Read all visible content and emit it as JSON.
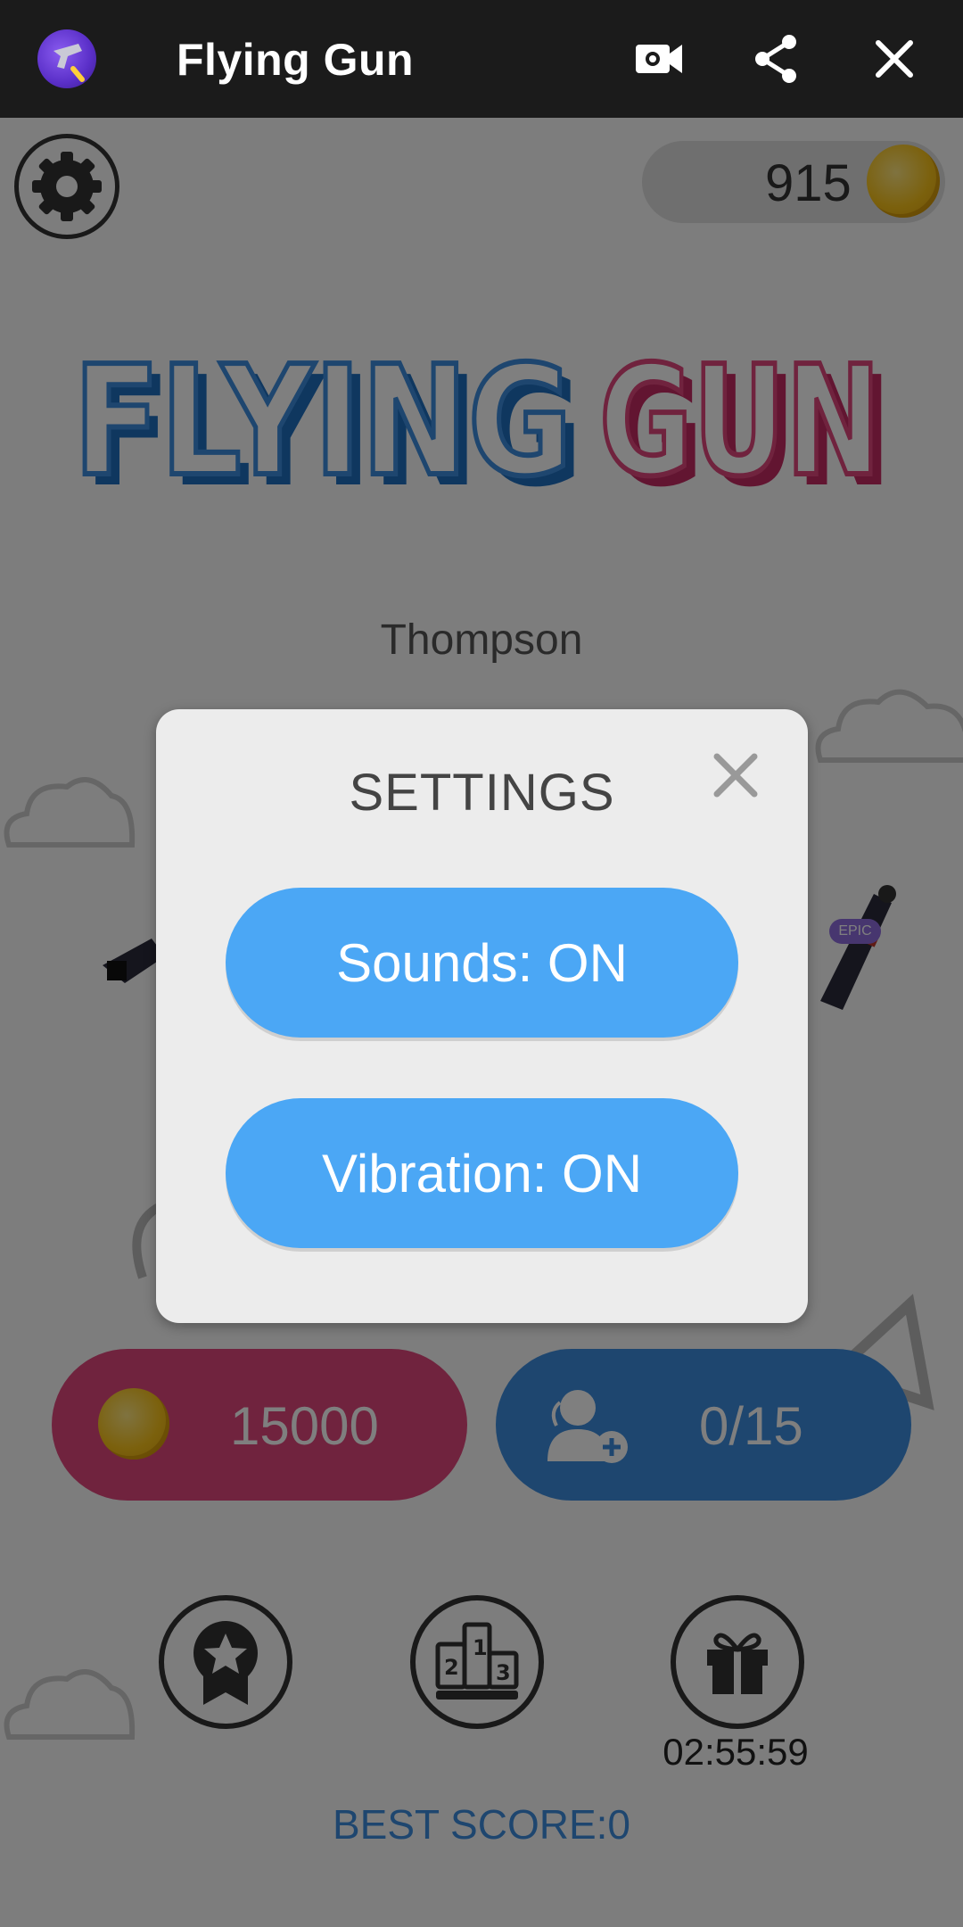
{
  "topbar": {
    "title": "Flying Gun",
    "icons": [
      "app-icon",
      "video-icon",
      "share-icon",
      "close-icon"
    ]
  },
  "game": {
    "coins": "915",
    "logo": {
      "part1": "FLYING",
      "part2": "GUN"
    },
    "gun_name": "Thompson",
    "badge": "EPIC",
    "buy_price": "15000",
    "invite_progress": "0/15",
    "gift_timer": "02:55:59",
    "best_score": "BEST SCORE:0",
    "colors": {
      "blue": "#3d8ddf",
      "pink": "#e0467d",
      "coin": "#f7c21a"
    }
  },
  "settings_dialog": {
    "title": "SETTINGS",
    "sounds_label": "Sounds: ON",
    "vibration_label": "Vibration: ON",
    "button_color": "#4ba7f5"
  }
}
